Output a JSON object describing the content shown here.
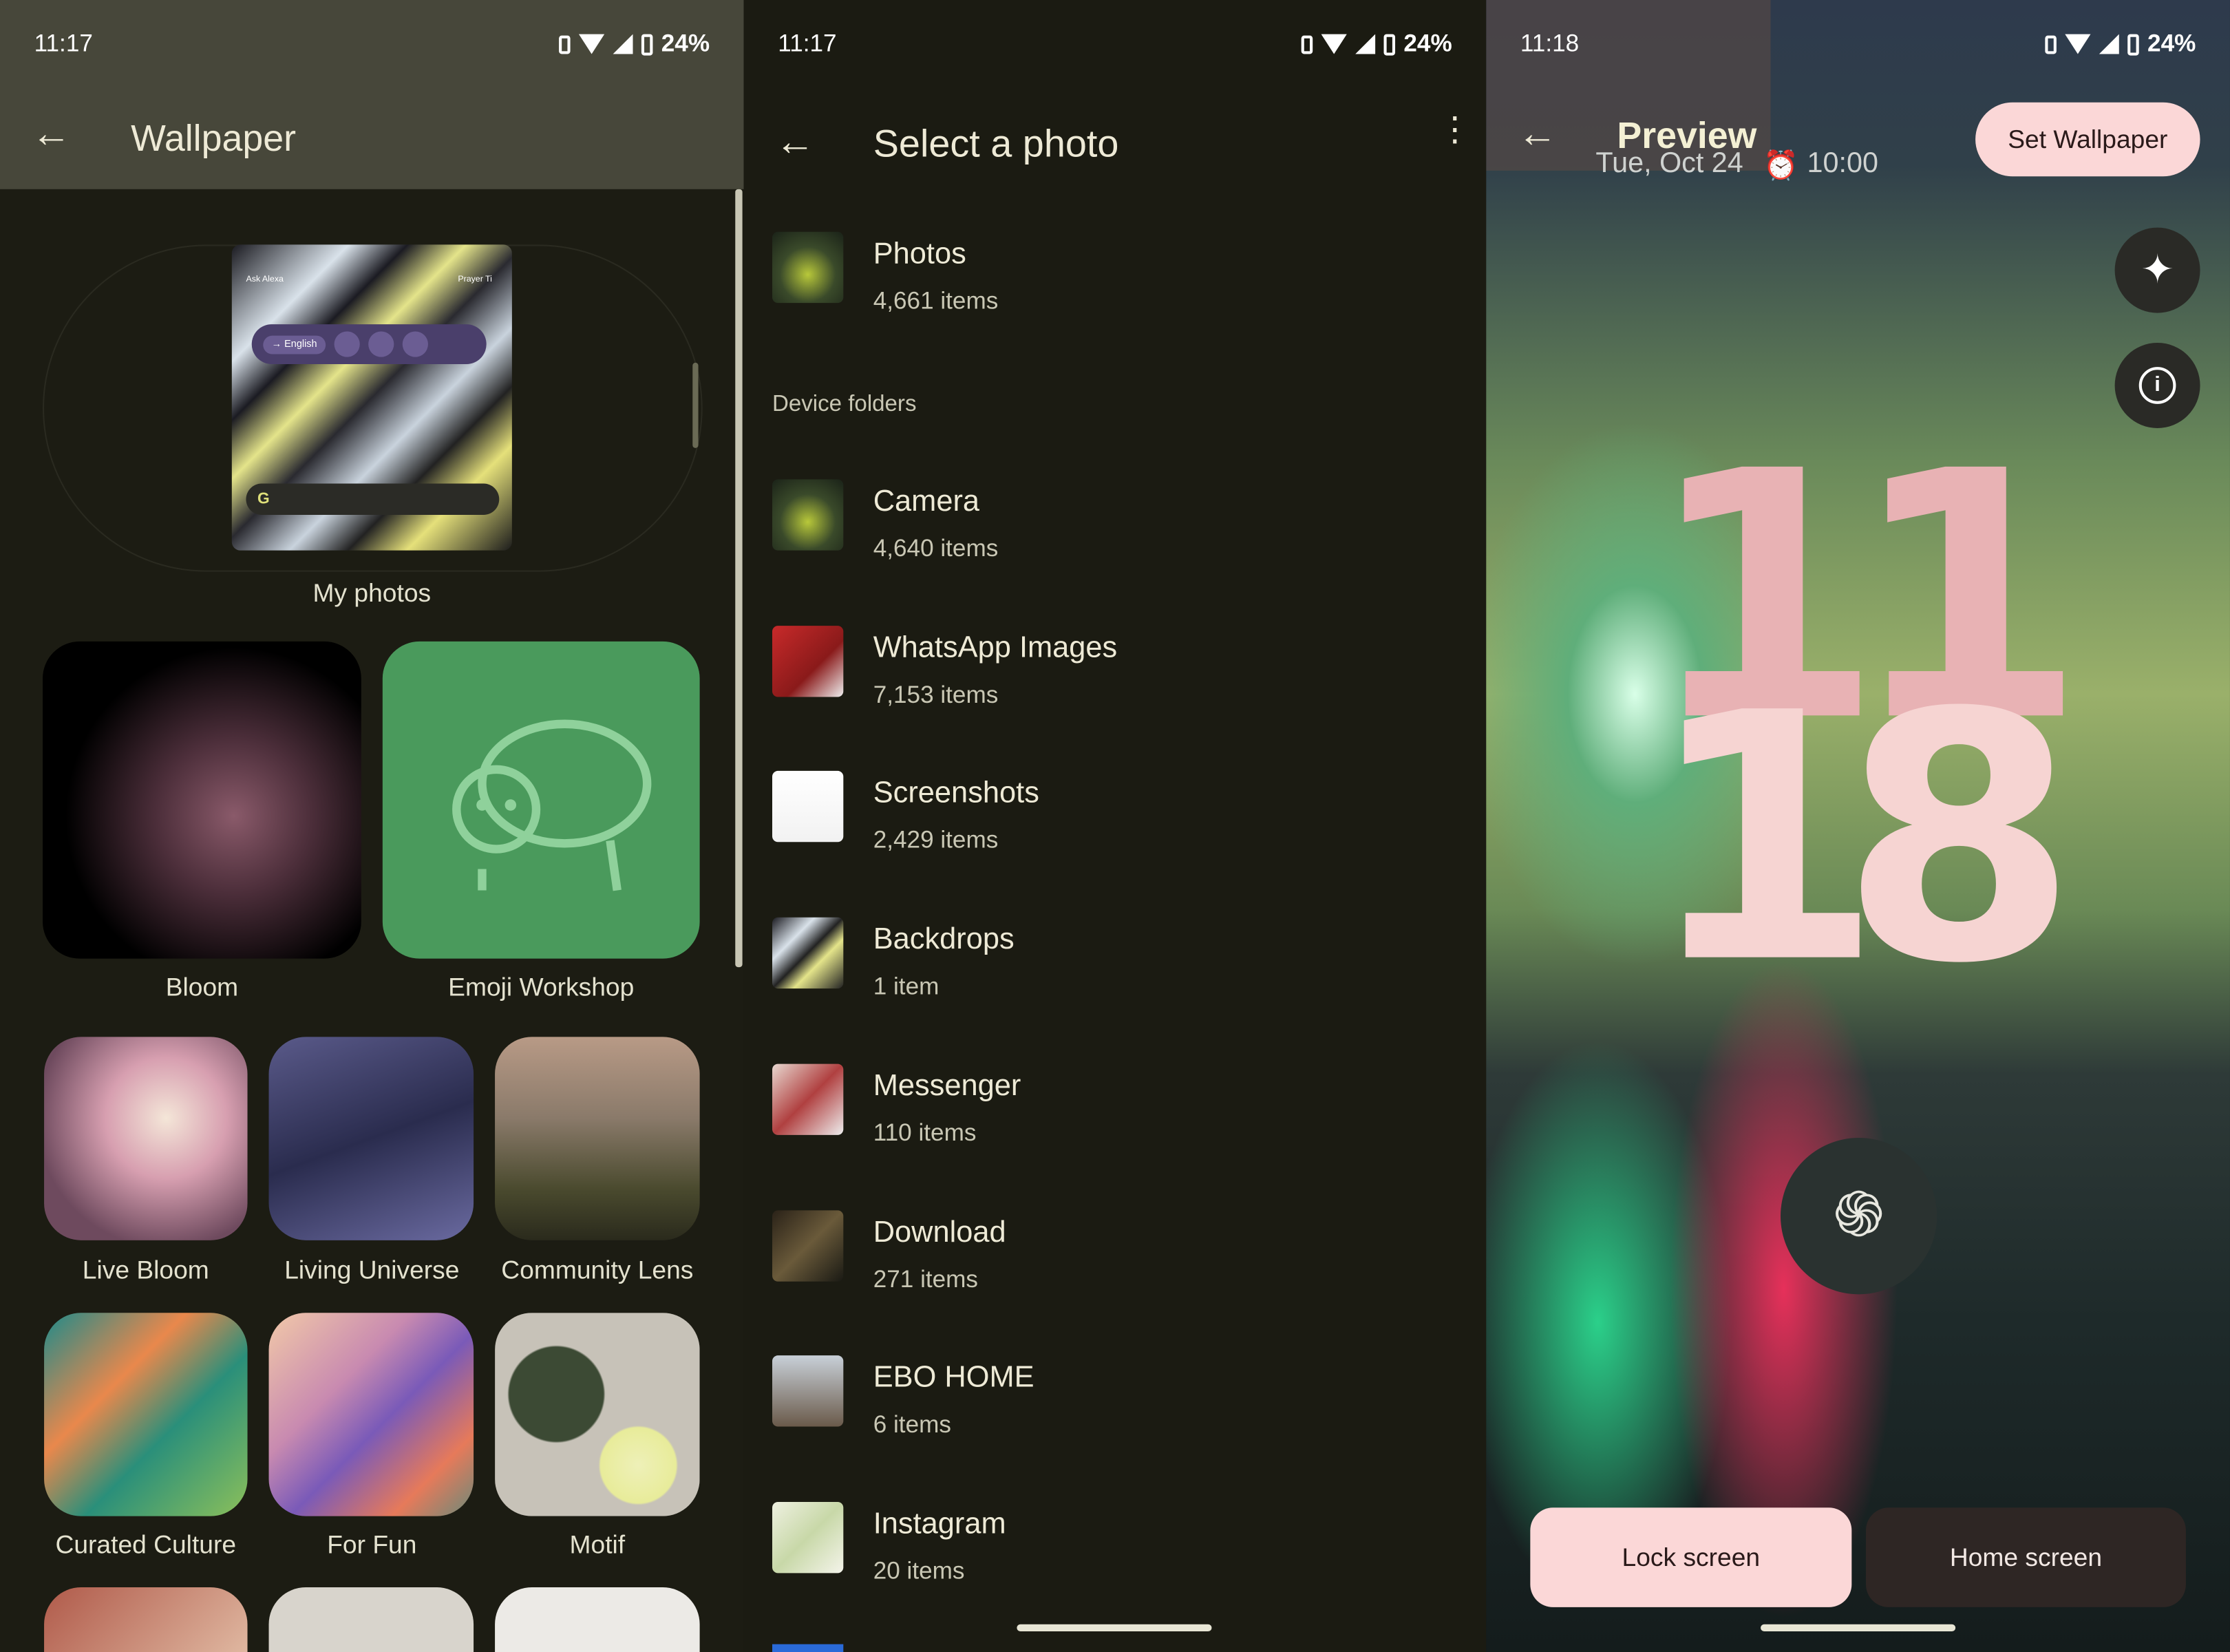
{
  "status_bars": [
    {
      "time": "11:17",
      "battery": "24%"
    },
    {
      "time": "11:17",
      "battery": "24%"
    },
    {
      "time": "11:18",
      "battery": "24%"
    }
  ],
  "wallpaper_screen": {
    "title": "Wallpaper",
    "my_photos_label": "My photos",
    "mini_preview": {
      "left_app": "Ask Alexa",
      "right_app": "Prayer Ti",
      "translate_chip": "→ English"
    },
    "categories": [
      {
        "label": "Bloom"
      },
      {
        "label": "Emoji Workshop"
      },
      {
        "label": "Live Bloom"
      },
      {
        "label": "Living Universe"
      },
      {
        "label": "Community Lens"
      },
      {
        "label": "Curated Culture"
      },
      {
        "label": "For Fun"
      },
      {
        "label": "Motif"
      }
    ],
    "colors": {
      "header": "#47473a",
      "emoji_workshop": "#4a9a5c"
    }
  },
  "select_photo_screen": {
    "title": "Select a photo",
    "top_album": {
      "name": "Photos",
      "count": "4,661 items"
    },
    "section_label": "Device folders",
    "folders": [
      {
        "name": "Camera",
        "count": "4,640 items"
      },
      {
        "name": "WhatsApp Images",
        "count": "7,153 items"
      },
      {
        "name": "Screenshots",
        "count": "2,429 items"
      },
      {
        "name": "Backdrops",
        "count": "1 item"
      },
      {
        "name": "Messenger",
        "count": "110 items"
      },
      {
        "name": "Download",
        "count": "271 items"
      },
      {
        "name": "EBO HOME",
        "count": "6 items"
      },
      {
        "name": "Instagram",
        "count": "20 items"
      }
    ]
  },
  "preview_screen": {
    "title": "Preview",
    "date": "Tue, Oct 24",
    "alarm": "10:00",
    "set_wallpaper": "Set Wallpaper",
    "clock_hours": "11",
    "clock_minutes": "18",
    "lock_screen": "Lock screen",
    "home_screen": "Home screen",
    "colors": {
      "accent": "#fbd7d7",
      "clock": "#e8b2b4"
    }
  }
}
